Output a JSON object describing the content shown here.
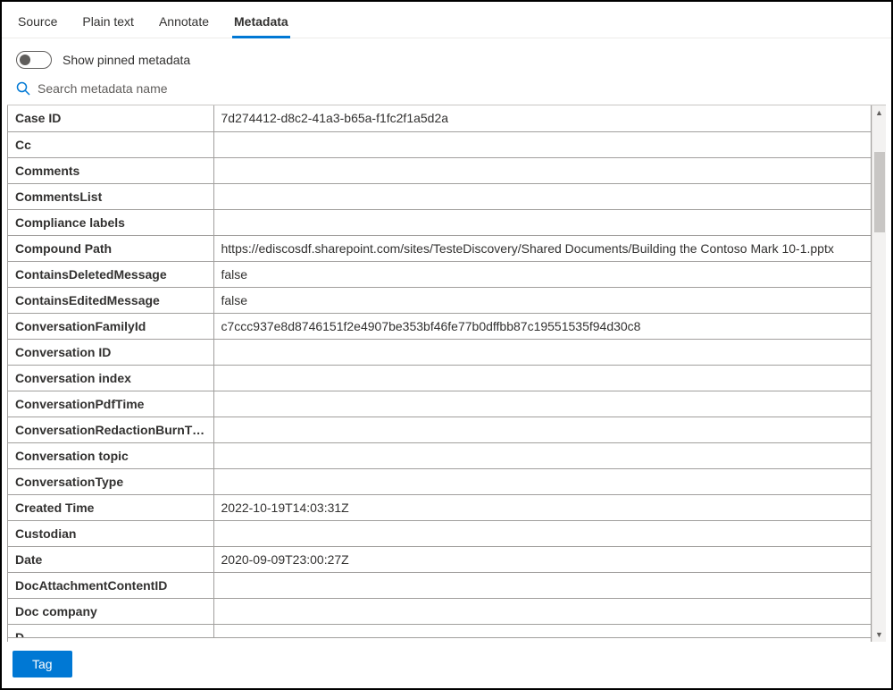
{
  "tabs": {
    "source": "Source",
    "plain_text": "Plain text",
    "annotate": "Annotate",
    "metadata": "Metadata"
  },
  "toggle": {
    "label": "Show pinned metadata"
  },
  "search": {
    "placeholder": "Search metadata name"
  },
  "rows": [
    {
      "key": "Case ID",
      "value": "7d274412-d8c2-41a3-b65a-f1fc2f1a5d2a"
    },
    {
      "key": "Cc",
      "value": ""
    },
    {
      "key": "Comments",
      "value": ""
    },
    {
      "key": "CommentsList",
      "value": ""
    },
    {
      "key": "Compliance labels",
      "value": ""
    },
    {
      "key": "Compound Path",
      "value": "https://ediscosdf.sharepoint.com/sites/TesteDiscovery/Shared Documents/Building the Contoso Mark 10-1.pptx"
    },
    {
      "key": "ContainsDeletedMessage",
      "value": "false"
    },
    {
      "key": "ContainsEditedMessage",
      "value": "false"
    },
    {
      "key": "ConversationFamilyId",
      "value": "c7ccc937e8d8746151f2e4907be353bf46fe77b0dffbb87c19551535f94d30c8"
    },
    {
      "key": "Conversation ID",
      "value": ""
    },
    {
      "key": "Conversation index",
      "value": ""
    },
    {
      "key": "ConversationPdfTime",
      "value": ""
    },
    {
      "key": "ConversationRedactionBurnTime",
      "value": ""
    },
    {
      "key": "Conversation topic",
      "value": ""
    },
    {
      "key": "ConversationType",
      "value": ""
    },
    {
      "key": "Created Time",
      "value": "2022-10-19T14:03:31Z"
    },
    {
      "key": "Custodian",
      "value": ""
    },
    {
      "key": "Date",
      "value": "2020-09-09T23:00:27Z"
    },
    {
      "key": "DocAttachmentContentID",
      "value": ""
    },
    {
      "key": "Doc company",
      "value": ""
    }
  ],
  "partial_row": {
    "key": "D",
    "value": ""
  },
  "footer": {
    "tag_button": "Tag"
  }
}
